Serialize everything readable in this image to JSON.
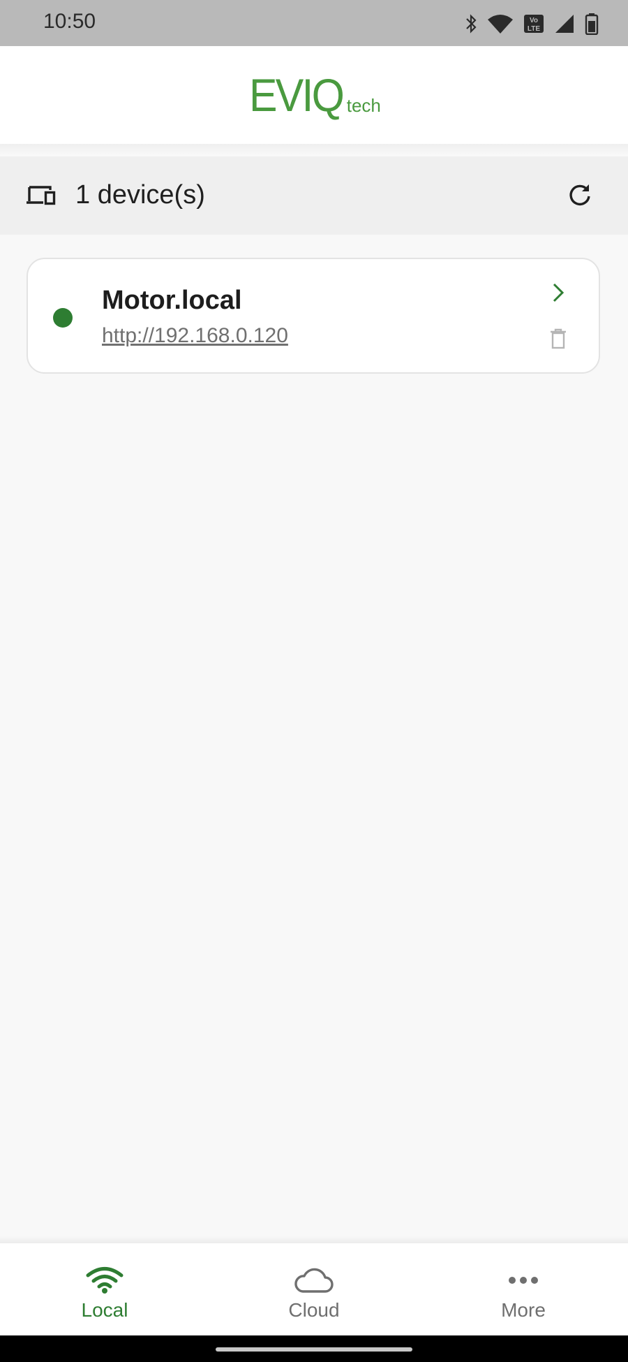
{
  "status_bar": {
    "time": "10:50",
    "icons": [
      "bluetooth-icon",
      "wifi-icon",
      "volte-icon",
      "cell-signal-icon",
      "battery-icon"
    ],
    "volte_text": "Vo LTE"
  },
  "header": {
    "logo_main": "EVIQ",
    "logo_sub": "tech",
    "logo_color": "#4a9a3f"
  },
  "devices": {
    "count_label": "1 device(s)",
    "icon": "devices-icon",
    "refresh_icon": "refresh-icon",
    "items": [
      {
        "name": "Motor.local",
        "url": "http://192.168.0.120",
        "status_color": "#2e7d32",
        "open_icon": "chevron-right-icon",
        "delete_icon": "trash-icon"
      }
    ]
  },
  "bottom_nav": {
    "items": [
      {
        "label": "Local",
        "icon": "wifi-icon",
        "active": true
      },
      {
        "label": "Cloud",
        "icon": "cloud-icon",
        "active": false
      },
      {
        "label": "More",
        "icon": "more-horizontal-icon",
        "active": false
      }
    ],
    "active_color": "#2e7d32",
    "inactive_color": "#6f6f6f"
  }
}
